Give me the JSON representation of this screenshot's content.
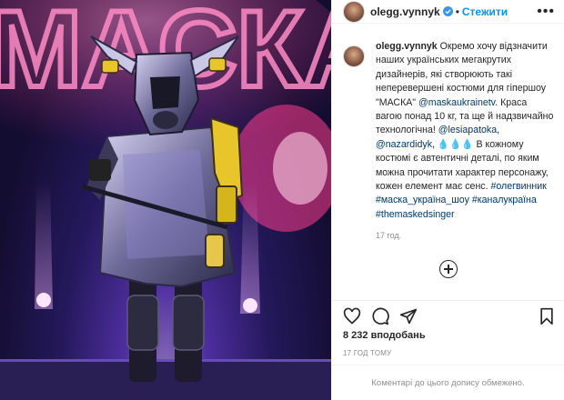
{
  "photo": {
    "sign_text": "МАСКА",
    "alt": "costume-photo"
  },
  "header": {
    "username": "olegg.vynnyk",
    "separator": "•",
    "follow_label": "Стежити",
    "more_label": "•••"
  },
  "caption": {
    "username": "olegg.vynnyk",
    "text_1": "Окремо хочу відзначити наших українських мегакрутих дизайнерів, які створюють такі неперевершені костюми для гіпершоу \"МАСКА\"",
    "mention_1": "@maskaukrainetv",
    "text_2": ". Краса вагою понад 10 кг, та ще й надзвичайно технологічна!",
    "mention_2": "@lesiapatoka",
    "comma": ",",
    "mention_3": "@nazardidyk",
    "emoji": "💧💧💧",
    "text_3": "В кожному костюмі є автентичні деталі, по яким можна прочитати характер персонажу, кожен елемент має сенс.",
    "hashtags": "#олегвинник #маска_україна_шоу #каналукраїна #themaskedsinger",
    "time_ago": "17 год."
  },
  "actions": {
    "likes": "8 232 вподобань",
    "timestamp": "17 ГОД ТОМУ"
  },
  "footer": {
    "comments_disabled": "Коментарі до цього допису обмежено."
  },
  "colors": {
    "accent": "#0095f6",
    "link": "#00376b",
    "muted": "#8e8e8e"
  }
}
